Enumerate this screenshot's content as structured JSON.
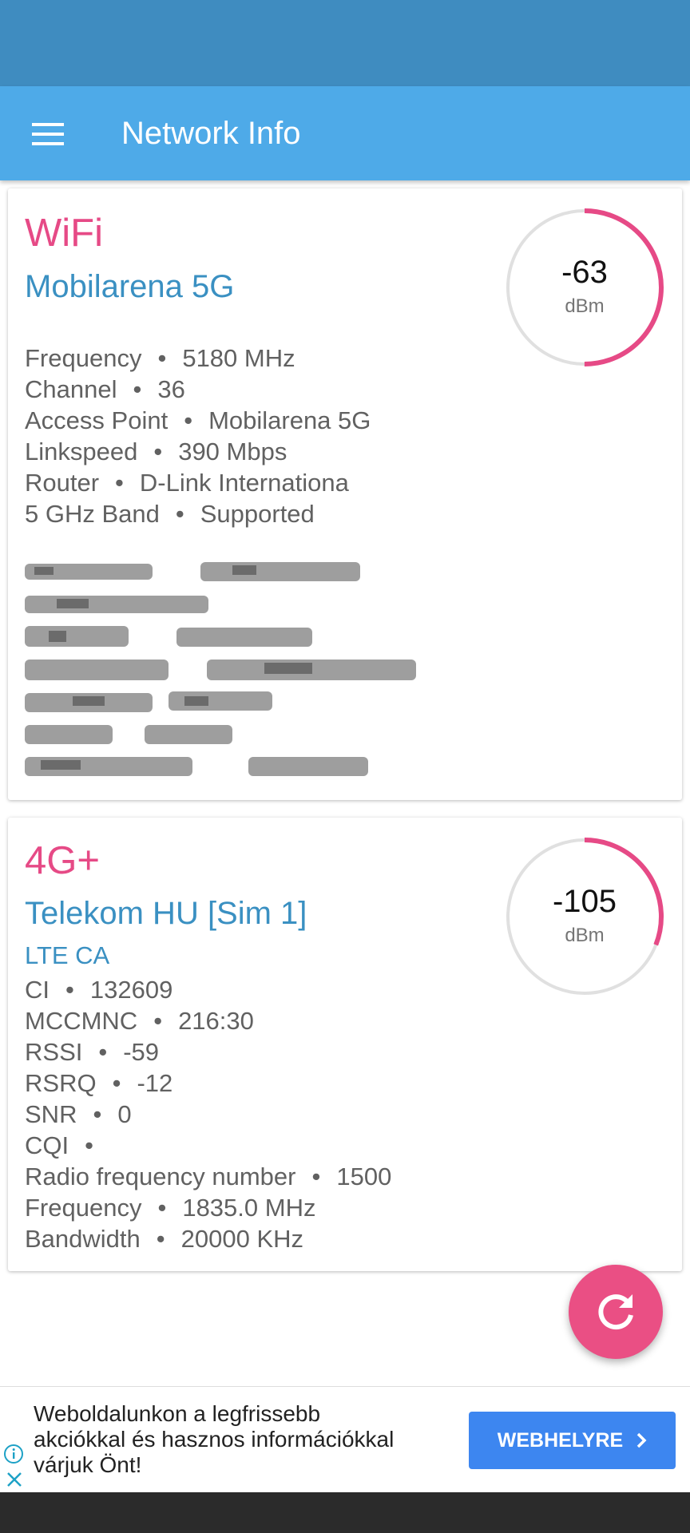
{
  "app_bar": {
    "title": "Network Info",
    "menu_icon": "hamburger-menu-icon",
    "color": "#4eaae8",
    "status_bar_color": "#3f8cc0"
  },
  "wifi_card": {
    "type_label": "WiFi",
    "network_name": "Mobilarena 5G",
    "signal": {
      "value": "-63",
      "unit": "dBm",
      "level": 0.5,
      "arc_color": "#e64a86"
    },
    "info": [
      {
        "label": "Frequency",
        "value": "5180 MHz"
      },
      {
        "label": "Channel",
        "value": "36"
      },
      {
        "label": "Access Point",
        "value": "Mobilarena 5G"
      },
      {
        "label": "Linkspeed",
        "value": "390 Mbps"
      },
      {
        "label": "Router",
        "value": "D-Link Internationa"
      },
      {
        "label": "5 GHz Band",
        "value": "Supported"
      }
    ]
  },
  "cell_card": {
    "type_label": "4G+",
    "operator": "Telekom HU [Sim 1]",
    "technology": "LTE CA",
    "signal": {
      "value": "-105",
      "unit": "dBm",
      "level": 0.31,
      "arc_color": "#e64a86"
    },
    "info": [
      {
        "label": "CI",
        "value": "132609"
      },
      {
        "label": "MCCMNC",
        "value": "216:30"
      },
      {
        "label": "RSSI",
        "value": "-59"
      },
      {
        "label": "RSRQ",
        "value": "-12"
      },
      {
        "label": "SNR",
        "value": "0"
      },
      {
        "label": "CQI",
        "value": ""
      },
      {
        "label": "Radio frequency number",
        "value": "1500"
      },
      {
        "label": "Frequency",
        "value": "1835.0 MHz"
      },
      {
        "label": "Bandwidth",
        "value": "20000 KHz"
      }
    ]
  },
  "separator": "•",
  "fab": {
    "icon": "refresh-icon",
    "color": "#ea4f84"
  },
  "ad": {
    "lines": [
      "Weboldalunkon a legfrissebb",
      "akciókkal és hasznos információkkal",
      "várjuk Önt!"
    ],
    "button_label": "WEBHELYRE",
    "info_icon": "info-icon",
    "close_icon": "close-icon",
    "button_color": "#3d86f0"
  }
}
